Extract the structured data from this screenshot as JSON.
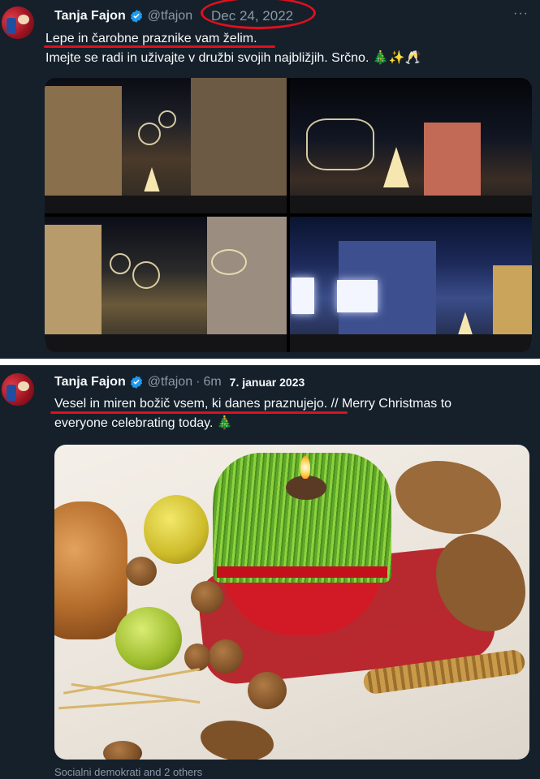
{
  "tweets": [
    {
      "author_name": "Tanja Fajon",
      "handle": "@tfajon",
      "date": "Dec 24, 2022",
      "more": "···",
      "line1": "Lepe in čarobne praznike vam želim.",
      "line2": "Imejte se radi in uživajte v družbi svojih najbližjih. Srčno. 🎄✨🥂"
    },
    {
      "author_name": "Tanja Fajon",
      "handle": "@tfajon",
      "separator": "·",
      "relative_time": "6m",
      "date_annotation": "7. januar 2023",
      "line1_underlined": "Vesel in miren božič vsem, ki danes praznujejo.",
      "line1_rest": " // Merry Christmas to",
      "line2": "everyone celebrating today. 🎄",
      "footer": "Socialni demokrati and 2 others"
    }
  ],
  "colors": {
    "background": "#15202b",
    "annotation_red": "#e0101c",
    "verified_blue": "#1d9bf0",
    "secondary_text": "#8b98a5"
  },
  "icons": [
    "verified-badge-icon",
    "more-options-icon"
  ]
}
